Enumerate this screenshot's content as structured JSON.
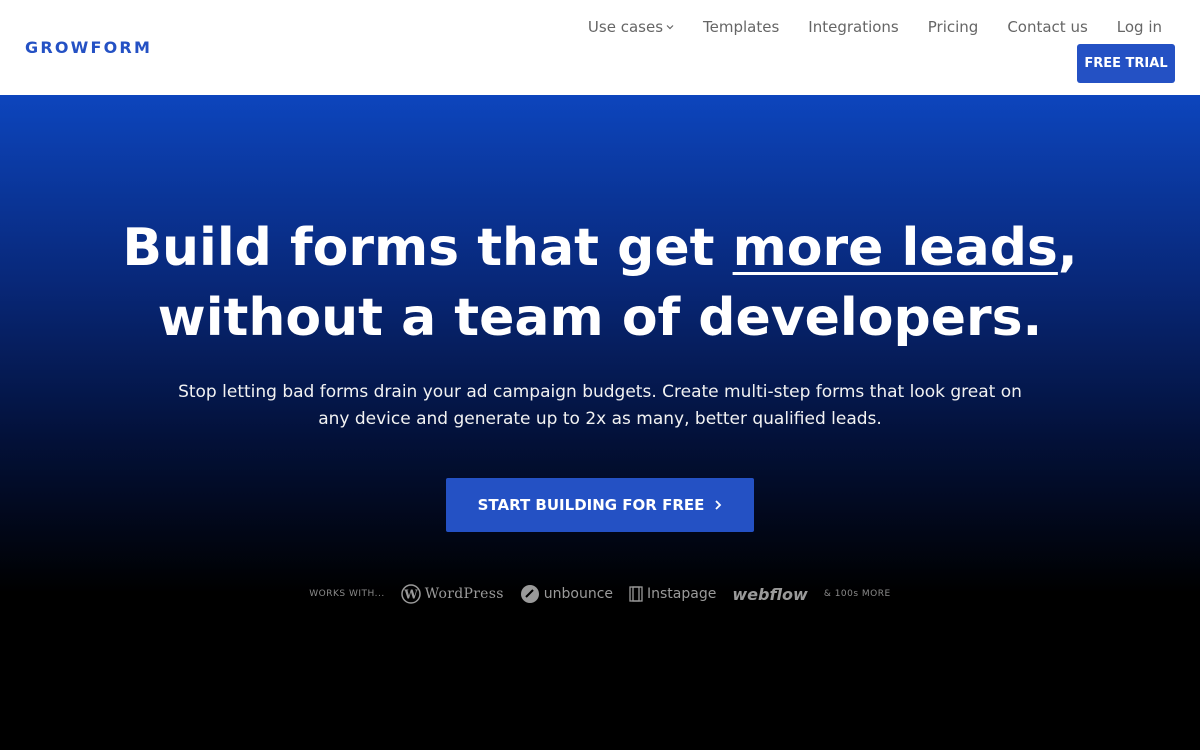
{
  "header": {
    "logo": "GROWFORM",
    "nav": [
      {
        "label": "Use cases",
        "has_dropdown": true
      },
      {
        "label": "Templates"
      },
      {
        "label": "Integrations"
      },
      {
        "label": "Pricing"
      },
      {
        "label": "Contact us"
      },
      {
        "label": "Log in"
      }
    ],
    "trial_button": "FREE TRIAL"
  },
  "hero": {
    "headline_part1": "Build forms that get ",
    "headline_highlight": "more leads",
    "headline_part2": ",",
    "headline_line2": "without a team of developers.",
    "subtext": "Stop letting bad forms drain your ad campaign budgets. Create multi-step forms that look great on any device and generate up to 2x as many, better qualified leads.",
    "cta_label": "START BUILDING FOR FREE",
    "cta_icon": "chevron-right-icon"
  },
  "works_with": {
    "label": "WORKS WITH...",
    "partners": [
      "WordPress",
      "unbounce",
      "Instapage",
      "webflow"
    ],
    "more": "& 100s MORE"
  },
  "colors": {
    "brand": "#2451c4",
    "hero_top": "#0d45bd",
    "hero_bottom": "#000000",
    "nav_text": "#666666"
  }
}
